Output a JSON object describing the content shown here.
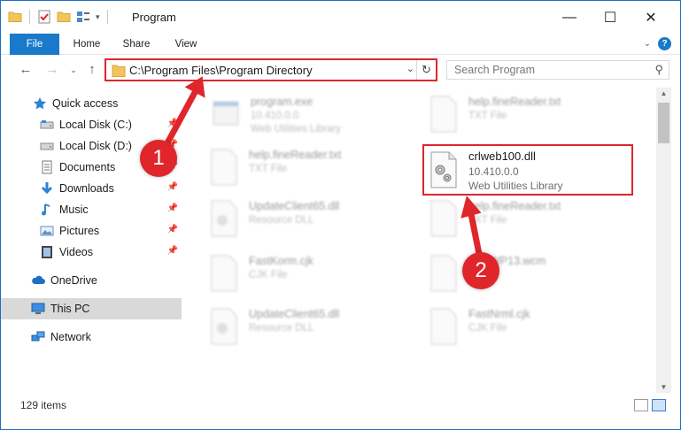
{
  "window": {
    "title": "Program",
    "controls": {
      "minimize": "—",
      "maximize": "☐",
      "close": "✕"
    }
  },
  "ribbon": {
    "tabs": [
      {
        "label": "File"
      },
      {
        "label": "Home"
      },
      {
        "label": "Share"
      },
      {
        "label": "View"
      }
    ]
  },
  "navigation": {
    "address_path": "C:\\Program Files\\Program Directory",
    "search_placeholder": "Search Program"
  },
  "sidebar": {
    "items": [
      {
        "label": "Quick access",
        "icon": "star-icon"
      },
      {
        "label": "Local Disk (C:)",
        "icon": "drive-icon"
      },
      {
        "label": "Local Disk (D:)",
        "icon": "drive-icon"
      },
      {
        "label": "Documents",
        "icon": "documents-icon"
      },
      {
        "label": "Downloads",
        "icon": "download-icon"
      },
      {
        "label": "Music",
        "icon": "music-icon"
      },
      {
        "label": "Pictures",
        "icon": "pictures-icon"
      },
      {
        "label": "Videos",
        "icon": "videos-icon"
      },
      {
        "label": "OneDrive",
        "icon": "cloud-icon"
      },
      {
        "label": "This PC",
        "icon": "computer-icon",
        "selected": true
      },
      {
        "label": "Network",
        "icon": "network-icon"
      }
    ]
  },
  "files": {
    "left_column": [
      {
        "name": "program.exe",
        "version": "10.410.0.0",
        "type": "Web Utilities Library"
      },
      {
        "name": "help.fineReader.txt",
        "version": "",
        "type": "TXT File"
      },
      {
        "name": "UpdateClient65.dll",
        "version": "",
        "type": "Resource DLL"
      },
      {
        "name": "FastKorm.cjk",
        "version": "",
        "type": "CJK File"
      },
      {
        "name": "UpdateClient65.dll",
        "version": "",
        "type": "Resource DLL"
      }
    ],
    "right_column": [
      {
        "name": "help.fineReader.txt",
        "version": "",
        "type": "TXT File"
      },
      {
        "name": "help.fineReader.txt",
        "version": "",
        "type": "TXT File"
      },
      {
        "name": "WP13.wcm",
        "version": "",
        "type": ""
      },
      {
        "name": "FastNrml.cjk",
        "version": "",
        "type": "CJK File"
      }
    ],
    "highlighted": {
      "name": "crlweb100.dll",
      "version": "10.410.0.0",
      "type": "Web Utilities Library"
    }
  },
  "annotations": {
    "marker_1": "1",
    "marker_2": "2",
    "color": "#e0252b"
  },
  "status": {
    "item_count": "129 items"
  },
  "colors": {
    "accent": "#1979ca",
    "highlight": "#e0252b",
    "selected_bg": "#d9d9d9"
  }
}
